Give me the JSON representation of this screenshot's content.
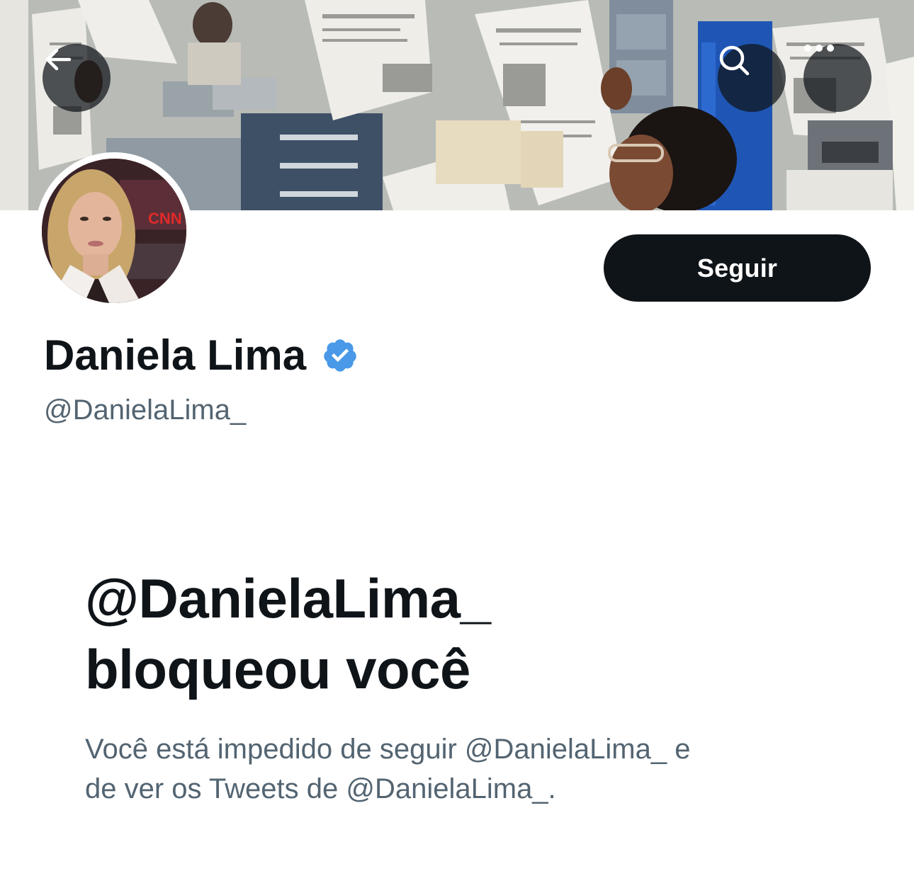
{
  "header": {
    "back_icon": "arrow-left-icon",
    "search_icon": "search-icon",
    "more_icon": "more-horizontal-icon"
  },
  "profile": {
    "display_name": "Daniela Lima",
    "handle": "@DanielaLima_",
    "verified": true,
    "verified_color": "#4a99e9",
    "follow_label": "Seguir",
    "avatar_logo_text": "CNN"
  },
  "blocked": {
    "title_line1": "@DanielaLima_",
    "title_line2": "bloqueou você",
    "desc_line1": "Você está impedido de seguir @DanielaLima_ e",
    "desc_line2": "de ver os Tweets de @DanielaLima_."
  },
  "colors": {
    "text_primary": "#0f1419",
    "text_secondary": "#536471",
    "button_bg": "#0f1419",
    "button_text": "#ffffff"
  }
}
